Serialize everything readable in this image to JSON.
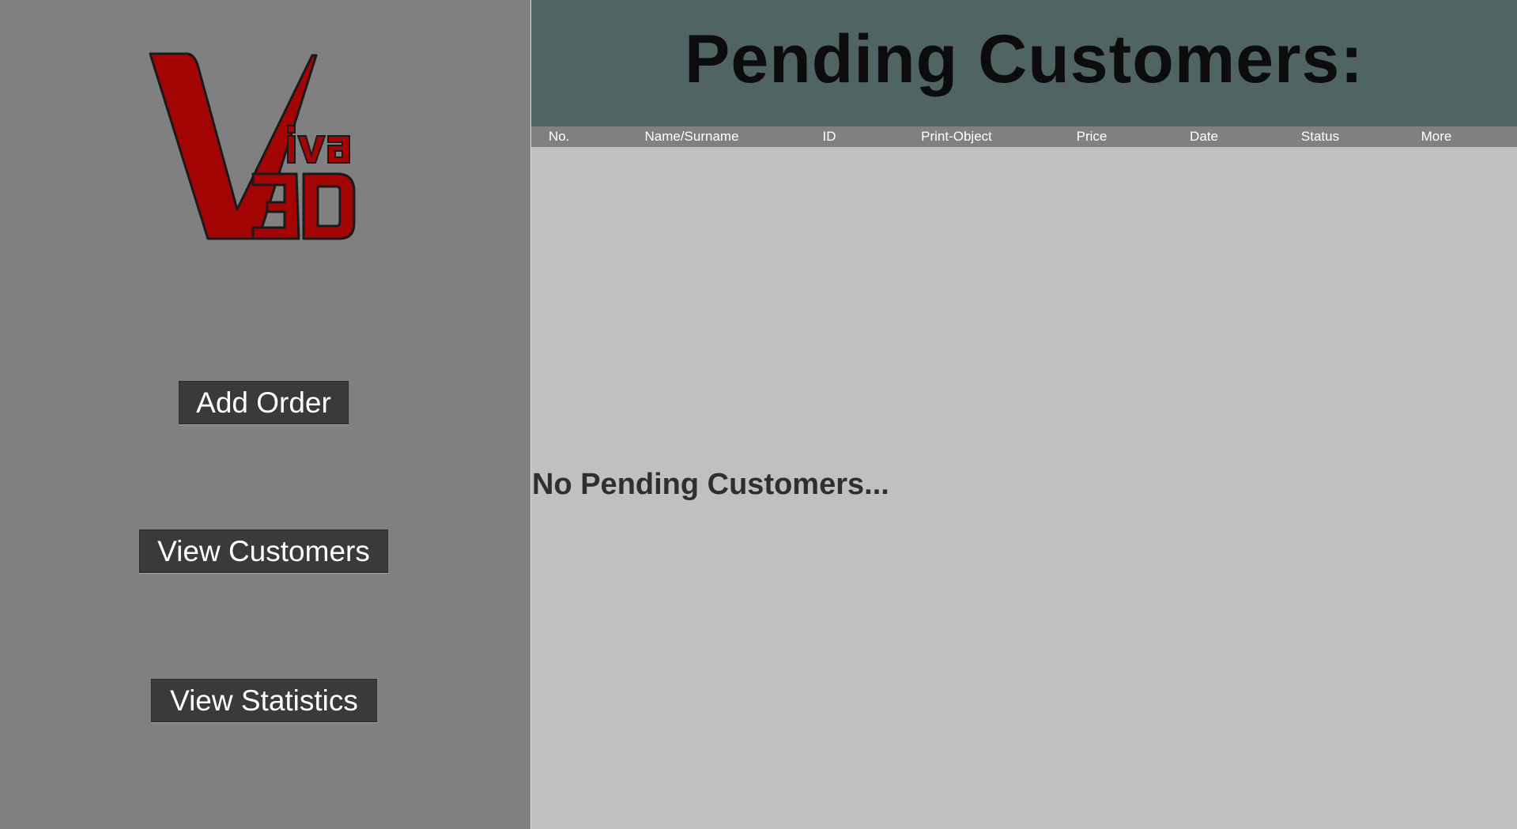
{
  "sidebar": {
    "logo": {
      "text_main": "V",
      "text_small": "iva",
      "text_3d": "3D",
      "color": "#a30505"
    },
    "buttons": {
      "add_order": "Add Order",
      "view_customers": "View Customers",
      "view_statistics": "View Statistics"
    }
  },
  "header": {
    "title": "Pending Customers:"
  },
  "table": {
    "columns": [
      "No.",
      "Name/Surname",
      "ID",
      "Print-Object",
      "Price",
      "Date",
      "Status",
      "More"
    ],
    "empty_message": "No Pending Customers..."
  },
  "colors": {
    "sidebar_bg": "#808080",
    "header_bg": "#506463",
    "content_bg": "#c0c0c0",
    "button_bg": "#3a3a3a"
  }
}
